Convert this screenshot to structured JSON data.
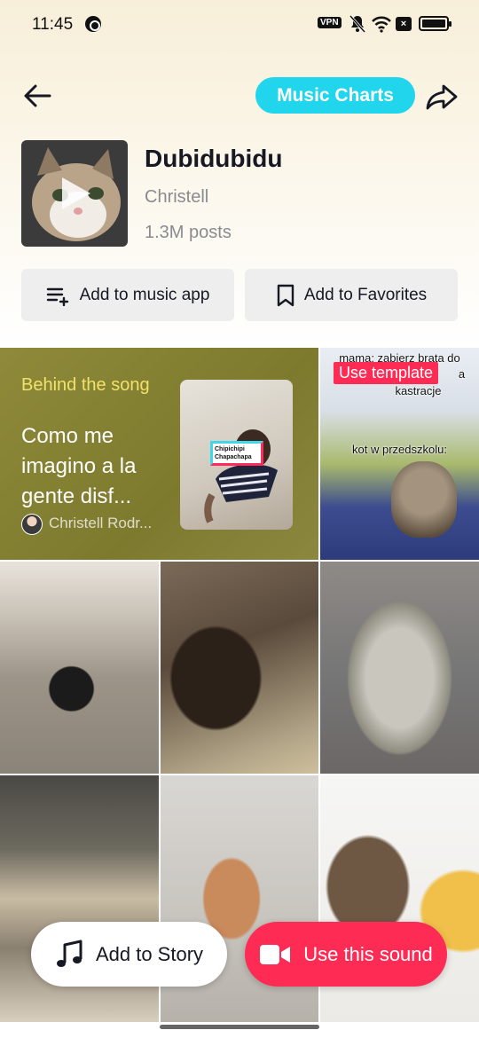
{
  "status_bar": {
    "time": "11:45",
    "vpn": "VPN"
  },
  "header": {
    "charts_label": "Music Charts"
  },
  "song": {
    "title": "Dubidubidu",
    "artist": "Christell",
    "posts": "1.3M posts"
  },
  "actions": {
    "add_music_app": "Add to music app",
    "add_favorites": "Add to Favorites"
  },
  "feature_card": {
    "kicker": "Behind the song",
    "description": "Como me imagino a la gente disf...",
    "author": "Christell Rodr...",
    "sticker_text": "Chipichipi Chapachapa"
  },
  "template_tile": {
    "caption_top": "mama: zabierz brata do",
    "caption_top_suffix": "a",
    "caption_mid": "kastracje",
    "badge": "Use template",
    "caption_bottom": "kot w przedszkolu:"
  },
  "bottom_actions": {
    "add_story": "Add to Story",
    "use_sound": "Use this sound"
  },
  "colors": {
    "accent_cyan": "#20d5ec",
    "primary_red": "#fe2c55",
    "feature_olive": "#8a8636",
    "kicker_yellow": "#f0e26a"
  },
  "icons": [
    "back-arrow-icon",
    "share-icon",
    "play-icon",
    "playlist-add-icon",
    "bookmark-icon",
    "music-note-icon",
    "video-camera-icon"
  ]
}
